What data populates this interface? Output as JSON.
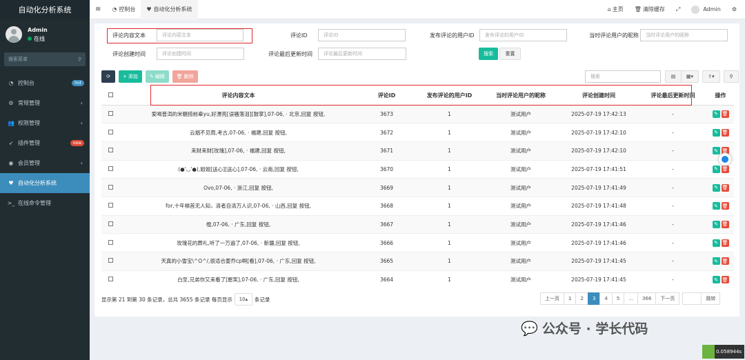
{
  "brand": "自动化分析系统",
  "user": {
    "name": "Admin",
    "status": "在线"
  },
  "sidebar": {
    "search_placeholder": "搜索菜单",
    "items": [
      {
        "label": "控制台",
        "icon": "dashboard-icon",
        "badge": "hot",
        "badge_color": "#3c8dbc"
      },
      {
        "label": "常规管理",
        "icon": "cogs-icon",
        "chevron": "‹"
      },
      {
        "label": "权限管理",
        "icon": "group-icon",
        "chevron": "‹"
      },
      {
        "label": "插件管理",
        "icon": "rocket-icon",
        "badge": "new",
        "badge_color": "#dd4b39"
      },
      {
        "label": "会员管理",
        "icon": "user-circle-icon",
        "chevron": "‹"
      },
      {
        "label": "自动化分析系统",
        "icon": "heart-icon",
        "active": true
      },
      {
        "label": "在线命令管理",
        "icon": "terminal-icon"
      }
    ]
  },
  "header": {
    "tabs": [
      "控制台",
      "自动化分析系统"
    ],
    "home": "主页",
    "clear_cache": "清除缓存",
    "user": "Admin"
  },
  "filters": {
    "comment_text_label": "评论内容文本",
    "comment_text_placeholder": "评论内容文本",
    "comment_id_label": "评论ID",
    "comment_id_placeholder": "评论ID",
    "user_id_label": "发布评论的用户ID",
    "user_id_placeholder": "发布评论的用户ID",
    "nickname_label": "当时评论用户的昵称",
    "nickname_placeholder": "当时评论用户的昵称",
    "created_label": "评论创建时间",
    "created_placeholder": "评论创建时间",
    "updated_label": "评论最后更新时间",
    "updated_placeholder": "评论最后更新时间",
    "search_btn": "搜索",
    "reset_btn": "重置"
  },
  "toolbar": {
    "add": "添加",
    "edit": "编辑",
    "delete": "删除",
    "search_placeholder": "搜索"
  },
  "table": {
    "columns": [
      "评论内容文本",
      "评论ID",
      "发布评论的用户ID",
      "当时评论用户的昵称",
      "评论创建时间",
      "评论最后更新时间",
      "操作"
    ],
    "rows": [
      [
        "爱喝普洱的米糖捞前辈yu,好漂亮[误骚落泪][鼓掌],07-06, · 北京,回复 按钮,",
        "3673",
        "1",
        "测试用户",
        "2025-07-19 17:42:13",
        "-"
      ],
      [
        "云烟不见雨,考古,07-06, · 福建,回复 按钮,",
        "3672",
        "1",
        "测试用户",
        "2025-07-19 17:42:10",
        "-"
      ],
      [
        "来财来财[玫瑰],07-06, · 福建,回复 按钮,",
        "3671",
        "1",
        "测试用户",
        "2025-07-19 17:42:10",
        "-"
      ],
      [
        "(●'◡'●),姐姐[送心][送心],07-06, · 云南,回复 按钮,",
        "3670",
        "1",
        "测试用户",
        "2025-07-19 17:41:51",
        "-"
      ],
      [
        "Ovo,07-06, · 浙江,回复 按钮,",
        "3669",
        "1",
        "测试用户",
        "2025-07-19 17:41:49",
        "-"
      ],
      [
        "for,十年梯首无人知，清者自清万人识,07-06, · 山西,回复 按钮,",
        "3668",
        "1",
        "测试用户",
        "2025-07-19 17:41:48",
        "-"
      ],
      [
        "棍,07-06, · 广东,回复 按钮,",
        "3667",
        "1",
        "测试用户",
        "2025-07-19 17:41:46",
        "-"
      ],
      [
        "玫瑰花的葬礼,听了一万遍了,07-06, · 新疆,回复 按钮,",
        "3666",
        "1",
        "测试用户",
        "2025-07-19 17:41:46",
        "-"
      ],
      [
        "天真的小雪宝\\^O^/,很适合姜乔cp啊[看],07-06, · 广东,回复 按钮,",
        "3665",
        "1",
        "测试用户",
        "2025-07-19 17:41:45",
        "-"
      ],
      [
        "白至,兄弟你又来看了[憨笑],07-06, · 广东,回复 按钮,",
        "3664",
        "1",
        "测试用户",
        "2025-07-19 17:41:45",
        "-"
      ]
    ]
  },
  "pagination": {
    "info_prefix": "显示第 21 到第 30 条记录，总共 3655 条记录 每页显示",
    "page_size": "10",
    "info_suffix": "条记录",
    "prev": "上一页",
    "pages": [
      "1",
      "2",
      "3",
      "4",
      "5",
      "...",
      "366"
    ],
    "active_page": "3",
    "next": "下一页",
    "jump": "跳转"
  },
  "watermark": "公众号 · 学长代码",
  "corner_badge": "0.058944s"
}
